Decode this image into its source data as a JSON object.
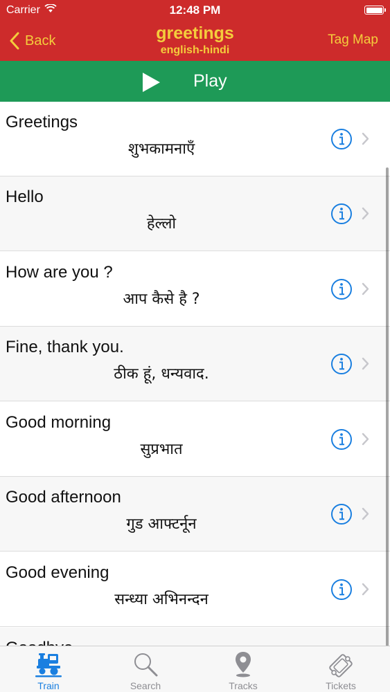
{
  "status_bar": {
    "carrier": "Carrier",
    "time": "12:48 PM"
  },
  "nav": {
    "back_label": "Back",
    "title": "greetings",
    "subtitle": "english-hindi",
    "right_label": "Tag Map"
  },
  "play": {
    "label": "Play"
  },
  "phrases": [
    {
      "english": "Greetings",
      "hindi": "शुभकामनाएँ"
    },
    {
      "english": "Hello",
      "hindi": "हेल्लो"
    },
    {
      "english": "How are you ?",
      "hindi": "आप कैसे है ?"
    },
    {
      "english": "Fine, thank you.",
      "hindi": "ठीक हूं, धन्यवाद."
    },
    {
      "english": "Good morning",
      "hindi": "सुप्रभात"
    },
    {
      "english": "Good afternoon",
      "hindi": "गुड आफ्टर्नून"
    },
    {
      "english": "Good evening",
      "hindi": "सन्ध्या अभिनन्दन"
    },
    {
      "english": "Goodbye",
      "hindi": ""
    }
  ],
  "tabs": [
    {
      "label": "Train",
      "icon": "train-icon",
      "active": true
    },
    {
      "label": "Search",
      "icon": "search-icon",
      "active": false
    },
    {
      "label": "Tracks",
      "icon": "map-pin-icon",
      "active": false
    },
    {
      "label": "Tickets",
      "icon": "ticket-icon",
      "active": false
    }
  ],
  "colors": {
    "nav_background": "#cd2b2b",
    "nav_accent": "#f4cd3c",
    "play_background": "#1e9a57",
    "info_blue": "#1a7fe0",
    "tab_active": "#1a7fe0",
    "tab_inactive": "#8e8e93"
  }
}
